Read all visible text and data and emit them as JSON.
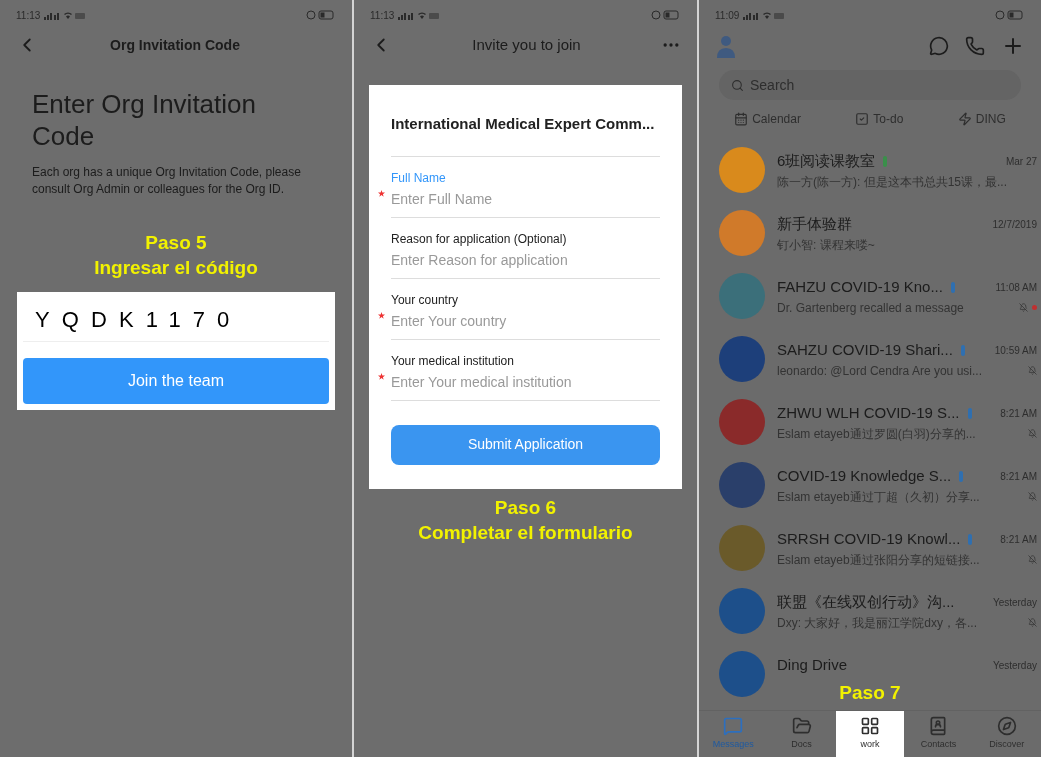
{
  "screens": [
    {
      "status_time": "11:13",
      "title": "Org Invitation Code",
      "heading": "Enter Org Invitation Code",
      "description": "Each org has a unique Org Invitation Code, please consult Org Admin or colleagues for the Org ID.",
      "step": [
        "Paso 5",
        "Ingresar el código"
      ],
      "code": "YQDK1170",
      "join_button": "Join the team"
    },
    {
      "status_time": "11:13",
      "title": "Invite you to join",
      "org_name": "International Medical Expert Comm...",
      "fields": [
        {
          "label": "Full Name",
          "placeholder": "Enter Full Name",
          "required": true,
          "focused": true
        },
        {
          "label": "Reason for application (Optional)",
          "placeholder": "Enter Reason for application",
          "required": false,
          "focused": false
        },
        {
          "label": "Your country",
          "placeholder": "Enter Your country",
          "required": true,
          "focused": false
        },
        {
          "label": "Your medical institution",
          "placeholder": "Enter Your medical institution",
          "required": true,
          "focused": false
        }
      ],
      "submit_button": "Submit Application",
      "step": [
        "Paso 6",
        "Completar el formulario"
      ]
    },
    {
      "status_time": "11:09",
      "search": {
        "placeholder": "Search"
      },
      "shortcuts": [
        "Calendar",
        "To-do",
        "DING"
      ],
      "chats": [
        {
          "name": "6班阅读课教室",
          "time": "Mar 27",
          "preview": "陈一方(陈一方): 但是这本书总共15课，最...",
          "color": "#d98a1c",
          "badge": {
            "color": "#3a8f4a"
          },
          "muted": false,
          "unread": false
        },
        {
          "name": "新手体验群",
          "time": "12/7/2019",
          "preview": "钉小智: 课程来喽~",
          "color": "#d07a2a",
          "muted": false,
          "unread": false
        },
        {
          "name": "FAHZU COVID-19 Kno...",
          "time": "11:08 AM",
          "preview": "Dr. Gartenberg recalled a message",
          "color": "#3b6f7a",
          "badge": {
            "color": "#2f6fb0"
          },
          "muted": true,
          "unread": true
        },
        {
          "name": "SAHZU COVID-19 Shari...",
          "time": "10:59 AM",
          "preview": "leonardo: @Lord Cendra  Are you usi...",
          "color": "#1d3f7a",
          "badge": {
            "color": "#2f6fb0"
          },
          "muted": true,
          "unread": false
        },
        {
          "name": "ZHWU WLH COVID-19 S...",
          "time": "8:21 AM",
          "preview": "Eslam etayeb通过罗圆(白羽)分享的...",
          "color": "#8a2a2a",
          "badge": {
            "color": "#2f6fb0"
          },
          "muted": true,
          "unread": false
        },
        {
          "name": "COVID-19 Knowledge S...",
          "time": "8:21 AM",
          "preview": "Eslam etayeb通过丁超（久初）分享...",
          "color": "#2a3f6a",
          "badge": {
            "color": "#2f6fb0"
          },
          "muted": true,
          "unread": false
        },
        {
          "name": "SRRSH COVID-19 Knowl...",
          "time": "8:21 AM",
          "preview": "Eslam etayeb通过张阳分享的短链接...",
          "color": "#6a5a2a",
          "badge": {
            "color": "#2f6fb0"
          },
          "muted": true,
          "unread": false
        },
        {
          "name": "联盟《在线双创行动》沟...",
          "time": "Yesterday",
          "preview": "Dxy: 大家好，我是丽江学院dxy，各...",
          "color": "#1d4f8a",
          "muted": true,
          "unread": false
        },
        {
          "name": "Ding Drive",
          "time": "Yesterday",
          "color": "#1d4f8a",
          "muted": false,
          "unread": false
        }
      ],
      "step": [
        "Paso 7"
      ],
      "tabs": [
        {
          "label": "Messages",
          "selected": true,
          "highlighted": false
        },
        {
          "label": "Docs",
          "selected": false,
          "highlighted": false
        },
        {
          "label": "work",
          "selected": false,
          "highlighted": true
        },
        {
          "label": "Contacts",
          "selected": false,
          "highlighted": false
        },
        {
          "label": "Discover",
          "selected": false,
          "highlighted": false
        }
      ]
    }
  ]
}
